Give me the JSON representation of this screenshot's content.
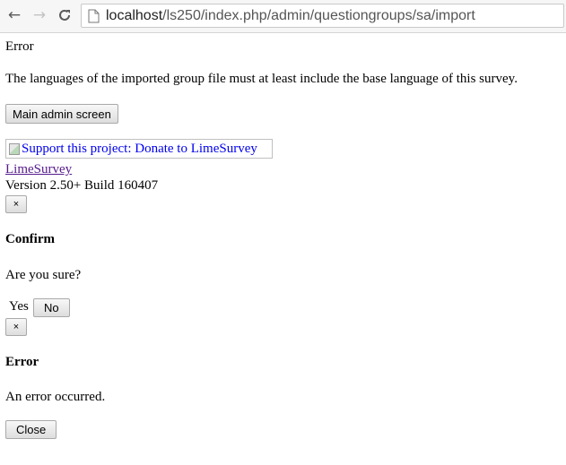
{
  "browser": {
    "url_host": "localhost",
    "url_path": "/ls250/index.php/admin/questiongroups/sa/import"
  },
  "error_block": {
    "title": "Error",
    "message": "The languages of the imported group file must at least include the base language of this survey.",
    "main_admin_button": "Main admin screen"
  },
  "footer": {
    "donate_alt": "Support this project: Donate to LimeSurvey",
    "limesurvey_link": "LimeSurvey",
    "version": "Version 2.50+ Build 160407"
  },
  "confirm_dialog": {
    "close_label": "×",
    "title": "Confirm",
    "body": "Are you sure?",
    "yes_label": "Yes",
    "no_label": "No"
  },
  "error_dialog": {
    "close_label": "×",
    "title": "Error",
    "body": "An error occurred.",
    "close_button": "Close"
  }
}
